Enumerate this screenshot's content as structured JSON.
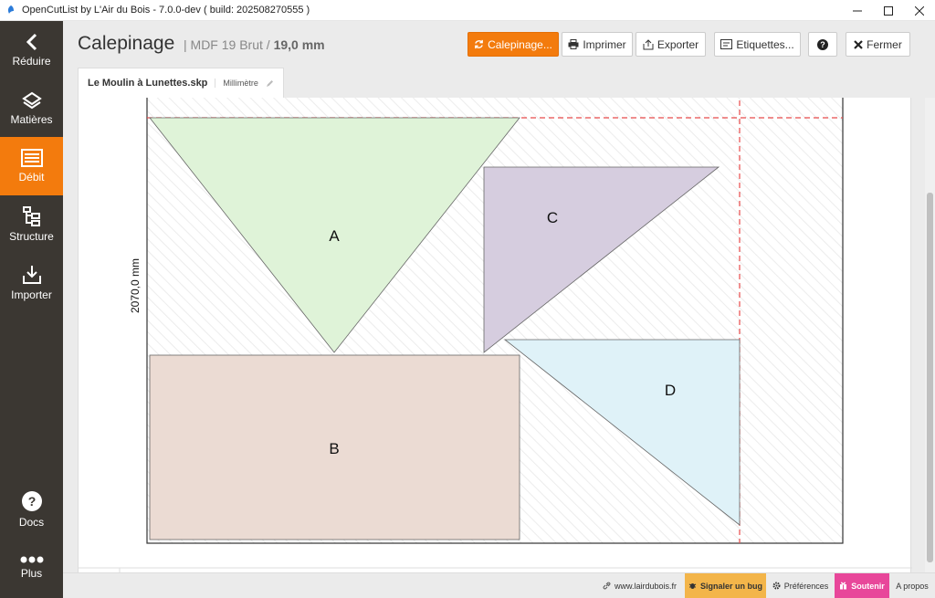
{
  "window": {
    "title": "OpenCutList by L'Air du Bois - 7.0.0-dev ( build: 202508270555 )"
  },
  "sidebar": {
    "items": [
      {
        "label": "Réduire",
        "icon": "chevron-left-icon"
      },
      {
        "label": "Matières",
        "icon": "materials-icon"
      },
      {
        "label": "Débit",
        "icon": "cutlist-icon",
        "active": true
      },
      {
        "label": "Structure",
        "icon": "structure-icon"
      },
      {
        "label": "Importer",
        "icon": "import-icon"
      },
      {
        "label": "Docs",
        "icon": "help-circle-icon"
      },
      {
        "label": "Plus",
        "icon": "more-dots-icon"
      }
    ]
  },
  "header": {
    "title": "Calepinage",
    "material": "MDF 19 Brut",
    "separator": "/",
    "thickness": "19,0 mm",
    "buttons": {
      "calepinage": "Calepinage...",
      "print": "Imprimer",
      "export": "Exporter",
      "labels": "Etiquettes...",
      "close": "Fermer"
    },
    "tab": {
      "file": "Le Moulin à Lunettes.skp",
      "unit": "Millimètre"
    }
  },
  "diagram": {
    "height_label": "2070,0 mm",
    "parts": [
      {
        "label": "A",
        "color": "#dff3d8"
      },
      {
        "label": "B",
        "color": "#ebdbd3"
      },
      {
        "label": "C",
        "color": "#d6cddf"
      },
      {
        "label": "D",
        "color": "#dff2f8"
      }
    ]
  },
  "footer": {
    "website": "www.lairdubois.fr",
    "bug": "Signaler un bug",
    "preferences": "Préférences",
    "support": "Soutenir",
    "about": "A propos"
  },
  "colors": {
    "accent": "#f37b0d",
    "sidebar": "#3b3732",
    "support": "#e8479a",
    "bug": "#f3b54a",
    "cut_line": "#e84a4a"
  }
}
